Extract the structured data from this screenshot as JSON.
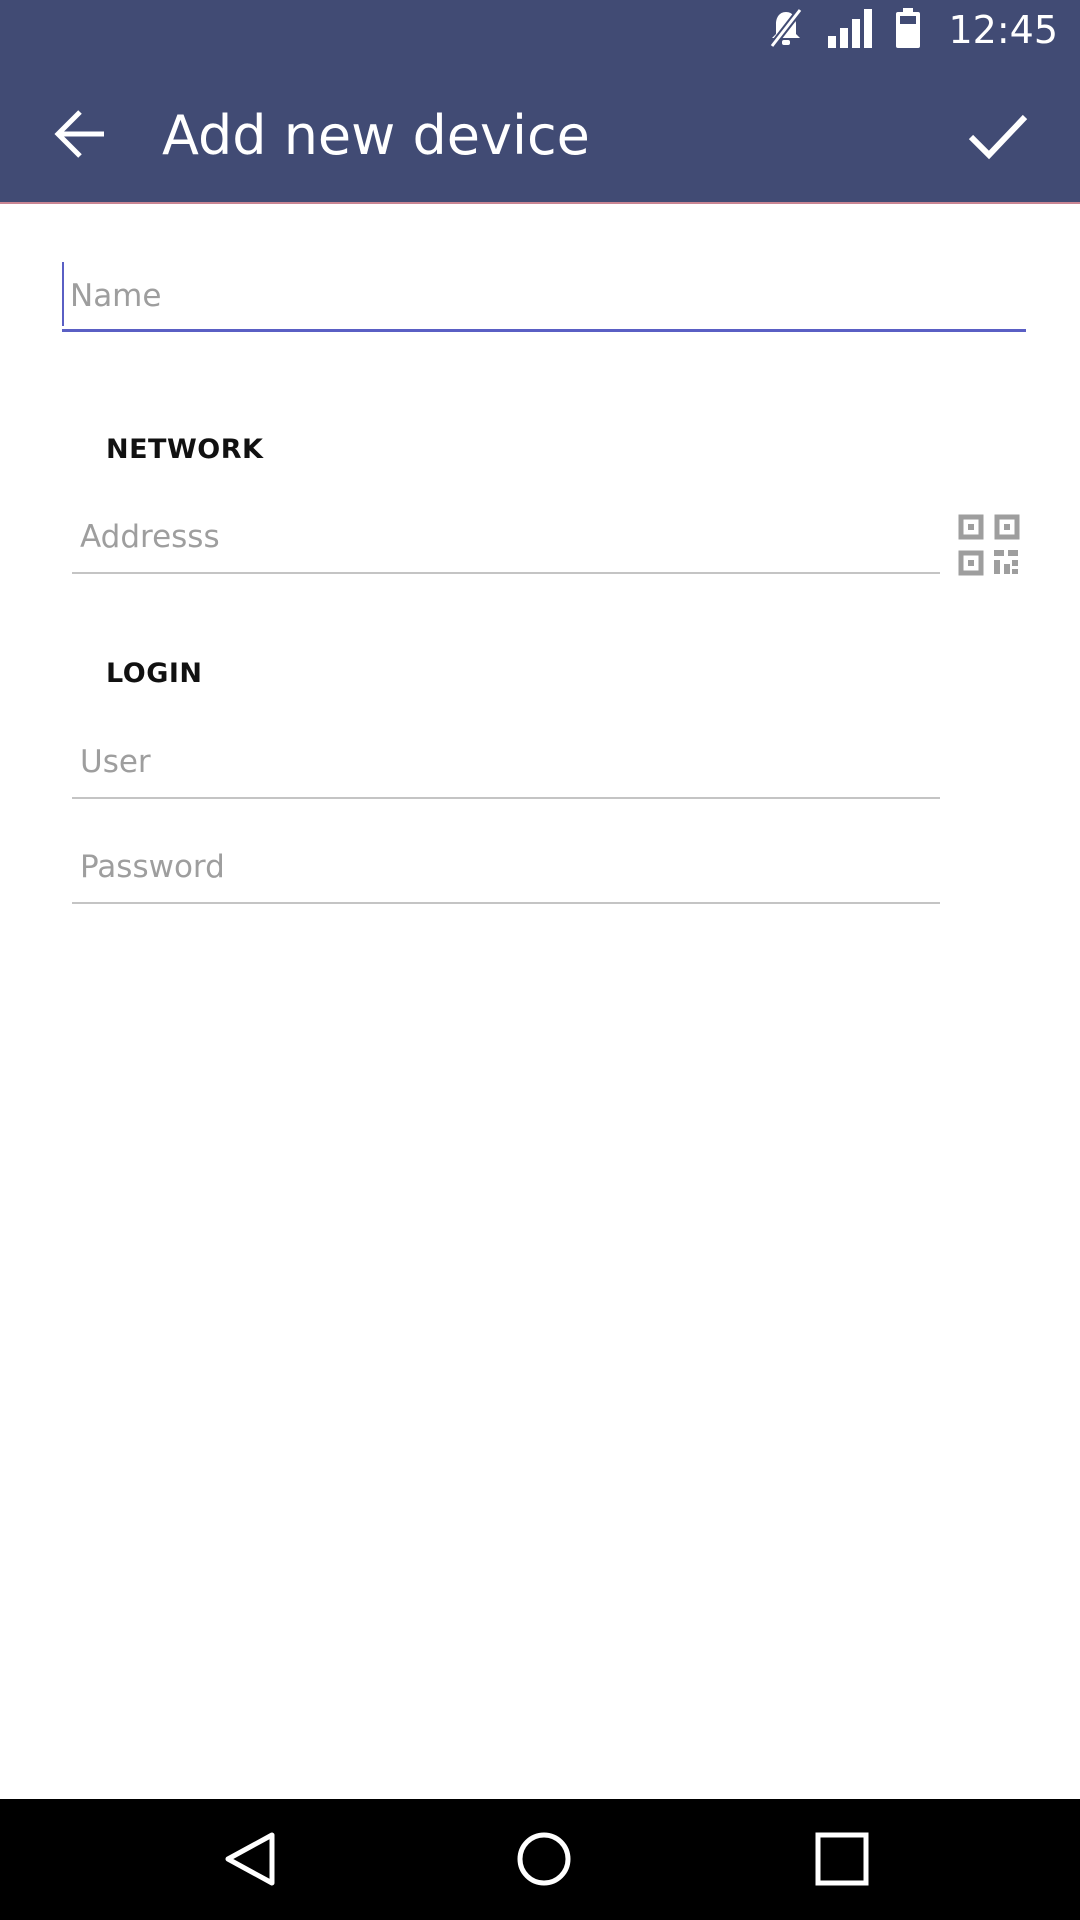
{
  "status_bar": {
    "time": "12:45",
    "icons": [
      "mute-icon",
      "signal-icon",
      "battery-icon"
    ]
  },
  "app_bar": {
    "title": "Add new device",
    "back_icon": "arrow-back-icon",
    "save_icon": "check-icon"
  },
  "form": {
    "name": {
      "placeholder": "Name",
      "value": ""
    },
    "network": {
      "header": "NETWORK",
      "address": {
        "placeholder": "Addresss",
        "value": ""
      },
      "scan_icon": "qr-code-icon"
    },
    "login": {
      "header": "LOGIN",
      "user": {
        "placeholder": "User",
        "value": ""
      },
      "password": {
        "placeholder": "Password",
        "value": ""
      }
    }
  },
  "nav_bar": {
    "icons": [
      "nav-back-icon",
      "nav-home-icon",
      "nav-recents-icon"
    ]
  },
  "colors": {
    "app_bar": "#414b74",
    "accent": "#5a5fc4",
    "divider": "#c4c4c4",
    "hint": "#9e9e9e"
  }
}
